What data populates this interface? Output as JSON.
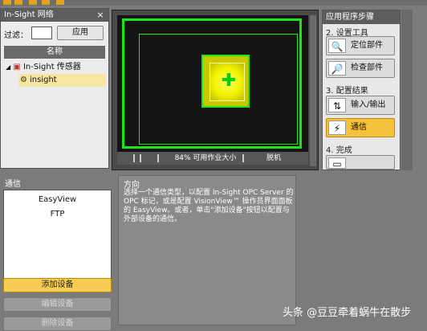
{
  "network_panel": {
    "title": "In-Sight 网络",
    "close": "×",
    "filter_label": "过滤：",
    "apply_button": "应用",
    "column_header": "名称",
    "tree": {
      "sensors": "In-Sight 传感器",
      "selected": "insight"
    }
  },
  "viewer": {
    "zoom_text": "84% 可用作业大小",
    "mode_text": "脱机"
  },
  "steps_panel": {
    "title": "应用程序步骤",
    "section2": "2. 设置工具",
    "locate_button": "定位部件",
    "inspect_button": "检查部件",
    "section3": "3. 配置结果",
    "io_button": "输入/输出",
    "comm_button": "通信",
    "section4": "4. 完成"
  },
  "comm_panel": {
    "title": "通信",
    "items": [
      "EasyView",
      "FTP"
    ],
    "add_button": "添加设备",
    "edit_button": "编辑设备",
    "delete_button": "删除设备"
  },
  "direction_panel": {
    "title": "方向",
    "text": "选择一个通信类型，以配置 In-Sight OPC Server 的 OPC 标记，或是配置 VisionView™ 操作员界面面板的 EasyView。或者，单击\"添加设备\"按钮以配置与外部设备的通信。"
  },
  "watermark": "头条 @豆豆牵着蜗牛在散步",
  "colors": {
    "accent": "#f7c23b",
    "roi_green": "#19e619"
  }
}
